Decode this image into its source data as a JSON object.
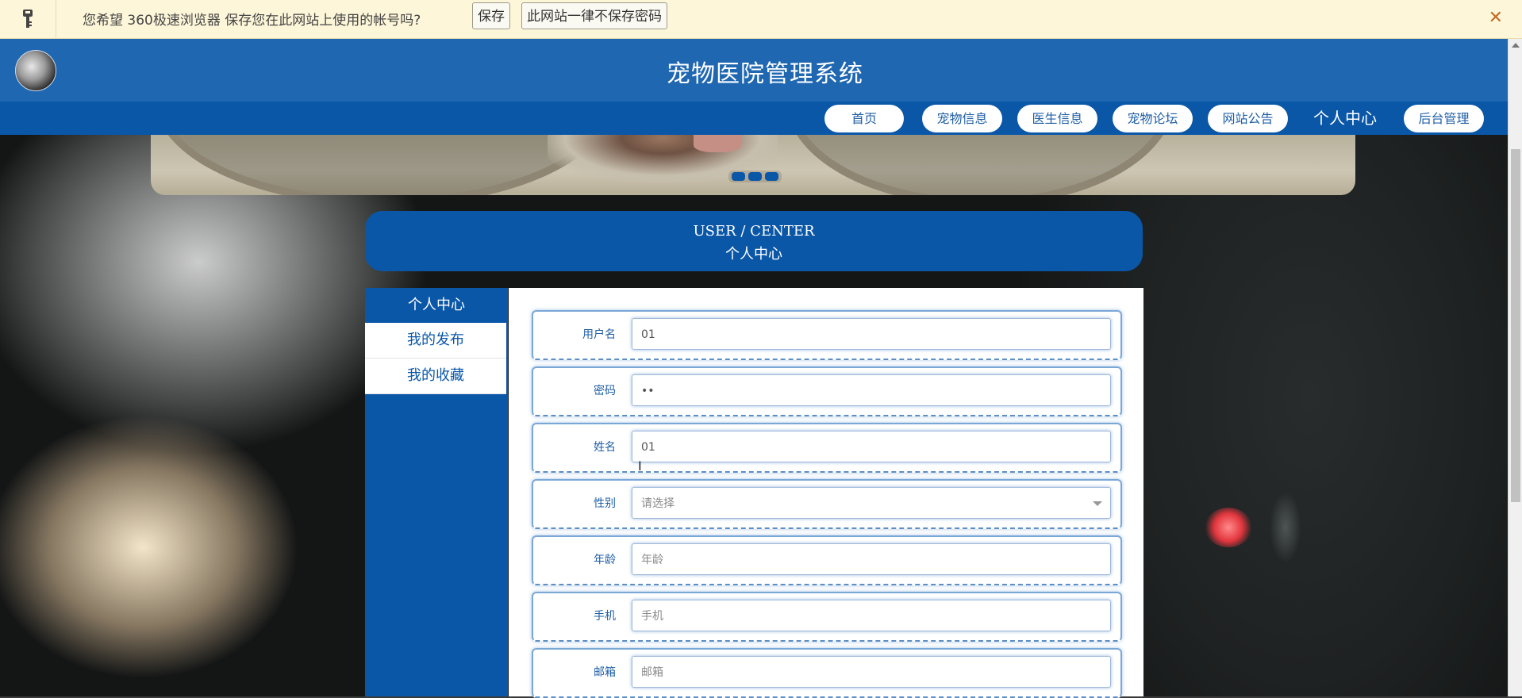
{
  "password_bar": {
    "message": "您希望 360极速浏览器 保存您在此网站上使用的帐号吗?",
    "save_label": "保存",
    "never_label": "此网站一律不保存密码",
    "close_glyph": "✕"
  },
  "header": {
    "title": "宠物医院管理系统"
  },
  "nav": {
    "items": [
      {
        "label": "首页"
      },
      {
        "label": "宠物信息"
      },
      {
        "label": "医生信息"
      },
      {
        "label": "宠物论坛"
      },
      {
        "label": "网站公告"
      },
      {
        "label": "个人中心",
        "active": true
      },
      {
        "label": "后台管理"
      }
    ]
  },
  "user_center": {
    "title_en": "USER / CENTER",
    "title_cn": "个人中心"
  },
  "side_menu": {
    "items": [
      {
        "label": "个人中心",
        "active": true
      },
      {
        "label": "我的发布"
      },
      {
        "label": "我的收藏"
      }
    ]
  },
  "form": {
    "fields": [
      {
        "label": "用户名",
        "value": "01"
      },
      {
        "label": "密码",
        "value": "••"
      },
      {
        "label": "姓名",
        "value": "01"
      },
      {
        "label": "性别",
        "value": "请选择"
      },
      {
        "label": "年龄",
        "placeholder": "年龄"
      },
      {
        "label": "手机",
        "placeholder": "手机"
      },
      {
        "label": "邮箱",
        "placeholder": "邮箱"
      }
    ]
  },
  "colors": {
    "primary": "#0a57a8",
    "header": "#1f67b1",
    "bar_bg": "#fdf6d9"
  },
  "icons": {
    "password_bar": "key-icon",
    "close": "close-icon",
    "select": "chevron-down-icon"
  }
}
